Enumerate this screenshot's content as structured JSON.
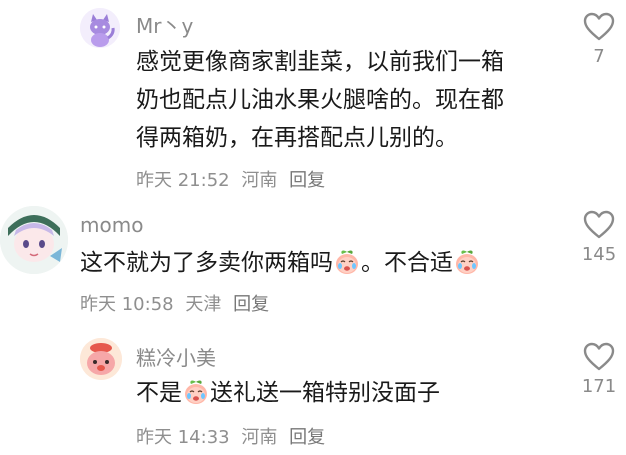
{
  "comments": [
    {
      "username": "Mr丶y",
      "text_lines": [
        "感觉更像商家割韭菜，以前我们一箱",
        "奶也配点儿油水果火腿啥的。现在都",
        "得两箱奶，在再搭配点儿别的。"
      ],
      "time": "昨天 21:52",
      "location": "河南",
      "reply_label": "回复",
      "likes": "7",
      "avatar_icon": "purple-cat-avatar"
    },
    {
      "username": "momo",
      "text_before_emoji": "这不就为了多卖你两箱吗",
      "text_middle": "。不合适",
      "emoji_icon": "crying-peach-emoji",
      "time": "昨天 10:58",
      "location": "天津",
      "reply_label": "回复",
      "likes": "145",
      "avatar_icon": "anime-girl-avatar"
    },
    {
      "username": "糕冷小美",
      "text_before_emoji": "不是",
      "text_after_emoji": "送礼送一箱特别没面子",
      "emoji_icon": "crying-peach-emoji",
      "time": "昨天 14:33",
      "location": "河南",
      "reply_label": "回复",
      "likes": "171",
      "avatar_icon": "pink-character-avatar"
    }
  ],
  "colors": {
    "text": "#1a1a1a",
    "username": "#8a8a8a",
    "meta": "#8f8f8f",
    "icon": "#8a8a8a"
  }
}
